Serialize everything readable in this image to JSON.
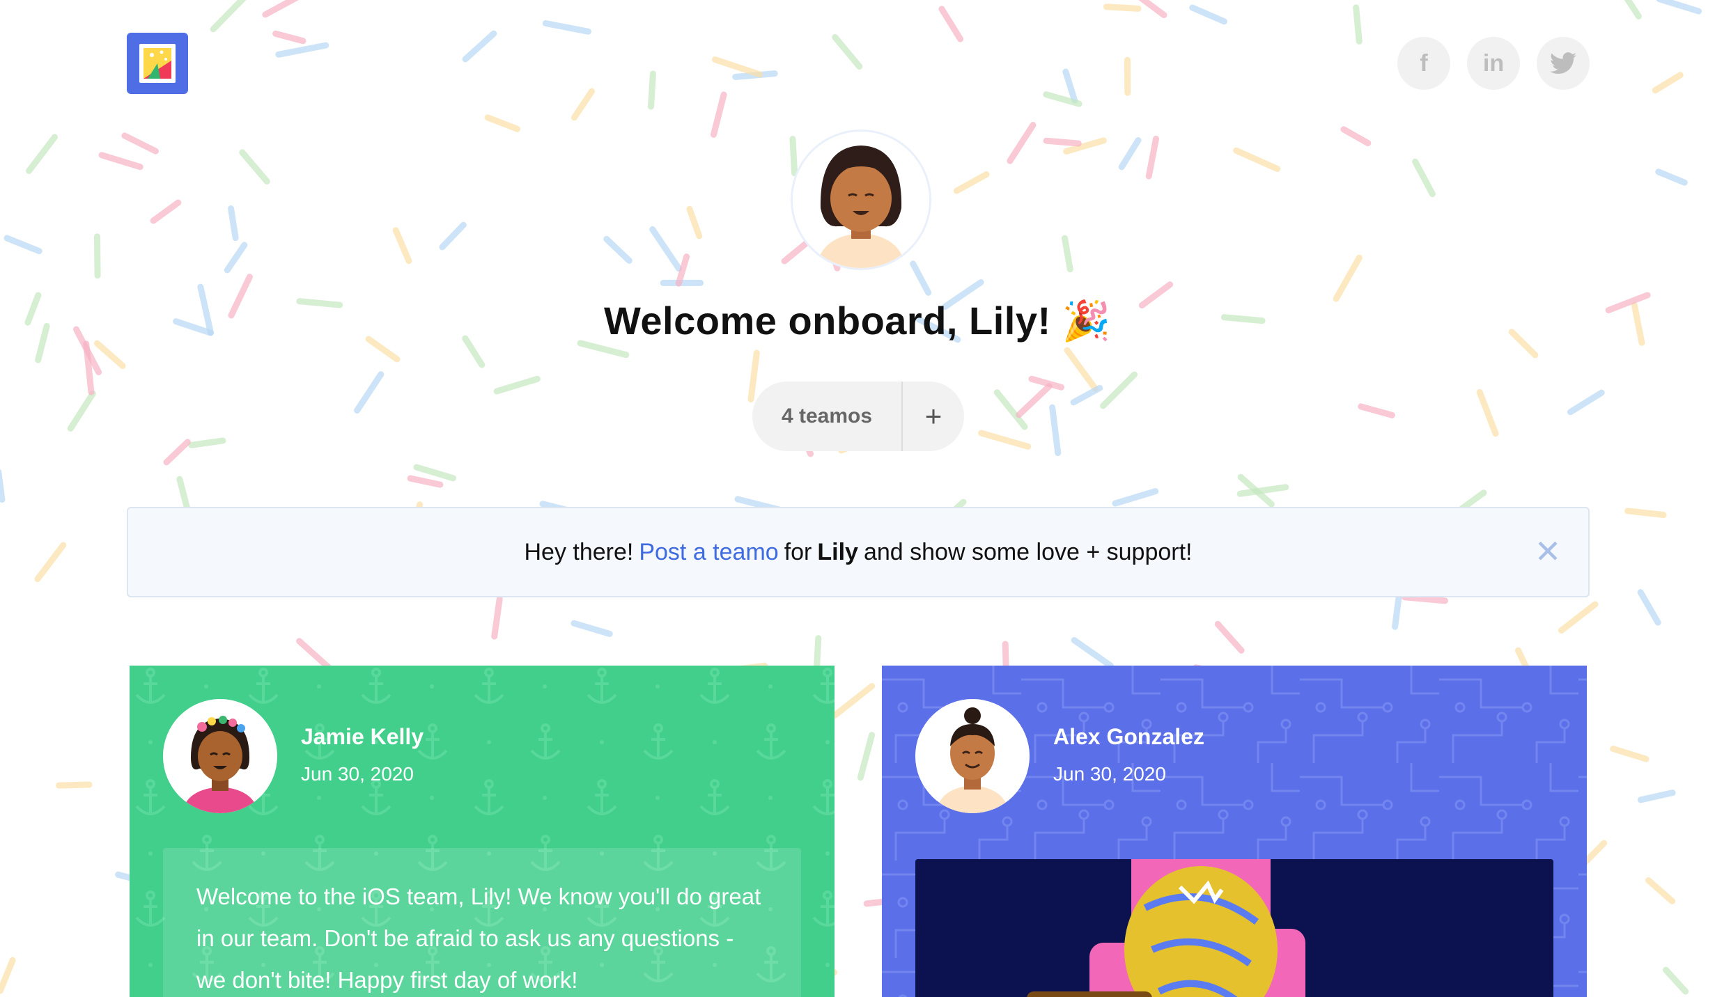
{
  "logo": {
    "icon": "postage-stamp-party-icon"
  },
  "social": [
    {
      "name": "facebook-icon",
      "glyph": "f"
    },
    {
      "name": "linkedin-icon",
      "glyph": "in"
    },
    {
      "name": "twitter-icon",
      "glyph": "🐦"
    }
  ],
  "hero": {
    "avatar_icon": "woman-avatar-icon",
    "title": "Welcome onboard, Lily! 🎉"
  },
  "teamos": {
    "count_label": "4 teamos",
    "add_label": "+"
  },
  "banner": {
    "prefix": "Hey there!",
    "link": "Post a teamo",
    "middle": "for",
    "name": "Lily",
    "suffix": "and show some love + support!",
    "close_label": "✕"
  },
  "cards": [
    {
      "author": "Jamie Kelly",
      "date": "Jun 30, 2020",
      "message": "Welcome to the iOS team, Lily! We know you'll do great in our team. Don't be afraid to ask us any questions - we don't bite! Happy first day of work!",
      "color": "#41cf8b",
      "pattern": "anchor-pattern"
    },
    {
      "author": "Alex Gonzalez",
      "date": "Jun 30, 2020",
      "color": "#5b6fe9",
      "pattern": "circuit-pattern",
      "media": "animated-gif"
    }
  ],
  "colors": {
    "link": "#3e6be0",
    "green_card": "#41cf8b",
    "blue_card": "#5b6fe9",
    "gif_bg": "#0c1150"
  }
}
